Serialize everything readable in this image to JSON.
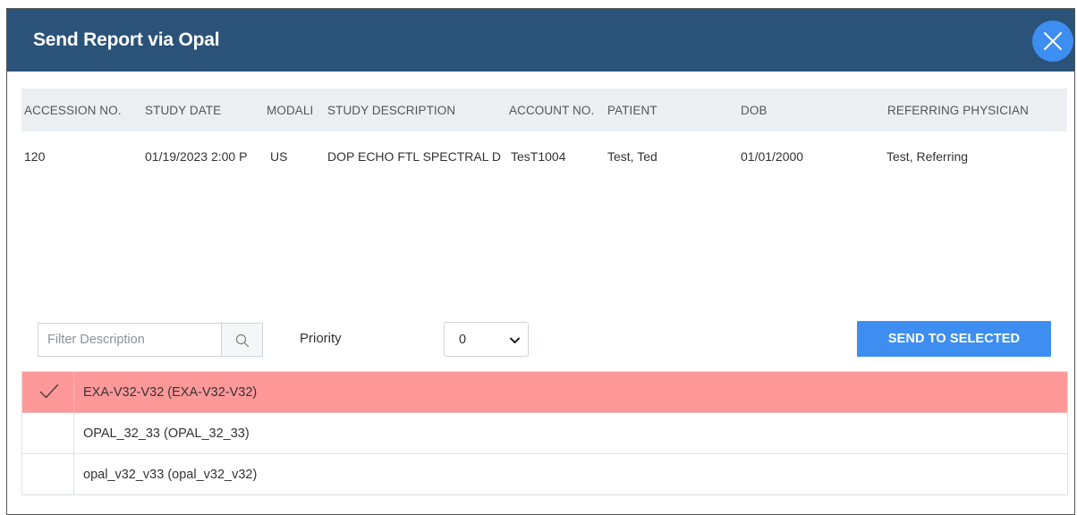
{
  "dialog": {
    "title": "Send Report via Opal",
    "close_icon": "close-icon"
  },
  "grid": {
    "columns": [
      "ACCESSION NO.",
      "STUDY DATE",
      "MODALI",
      "STUDY DESCRIPTION",
      "ACCOUNT NO.",
      "PATIENT",
      "DOB",
      "REFERRING PHYSICIAN"
    ],
    "rows": [
      {
        "accession_no": "120",
        "study_date": "01/19/2023 2:00 P",
        "modality": "US",
        "study_description": "DOP ECHO FTL SPECTRAL D",
        "account_no": "TesT1004",
        "patient": "Test, Ted",
        "dob": "01/01/2000",
        "referring_physician": "Test, Referring"
      }
    ]
  },
  "toolbar": {
    "filter_placeholder": "Filter Description",
    "filter_icon": "search-icon",
    "priority_label": "Priority",
    "priority_value": "0",
    "send_label": "SEND TO SELECTED"
  },
  "destinations": [
    {
      "label": "EXA-V32-V32 (EXA-V32-V32)",
      "selected": true
    },
    {
      "label": "OPAL_32_33 (OPAL_32_33)",
      "selected": false
    },
    {
      "label": "opal_v32_v33 (opal_v32_v32)",
      "selected": false
    }
  ],
  "colors": {
    "header_bg": "#2b5278",
    "accent": "#3d8ef0",
    "selected_row": "#ff9999",
    "grid_header_bg": "#eceff2"
  }
}
